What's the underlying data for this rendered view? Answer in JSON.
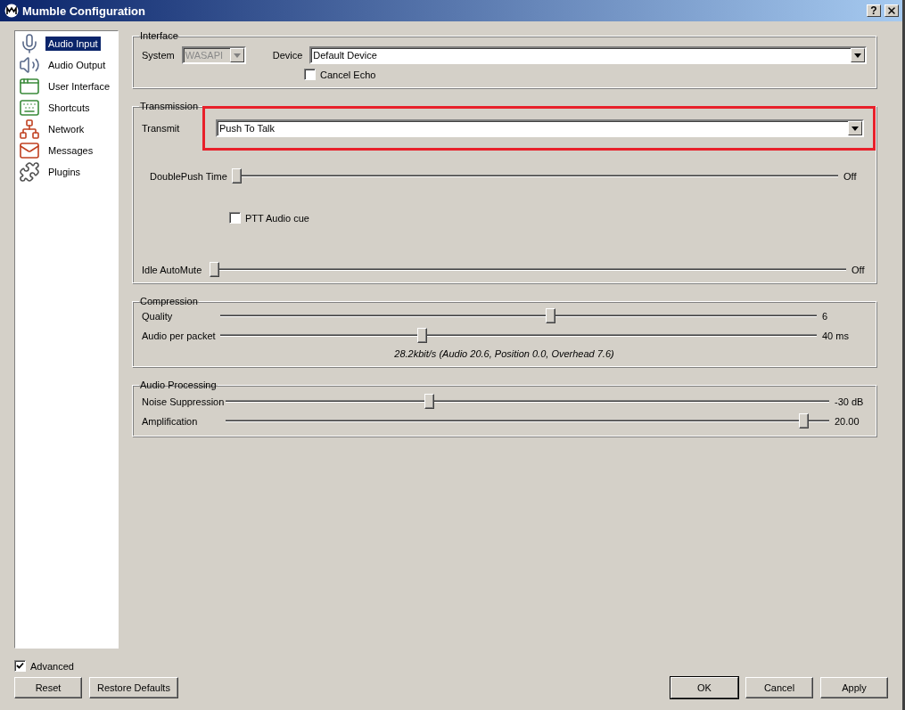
{
  "window": {
    "title": "Mumble Configuration",
    "help_button": "?"
  },
  "sidebar": {
    "items": [
      {
        "label": "Audio Input",
        "selected": true
      },
      {
        "label": "Audio Output",
        "selected": false
      },
      {
        "label": "User Interface",
        "selected": false
      },
      {
        "label": "Shortcuts",
        "selected": false
      },
      {
        "label": "Network",
        "selected": false
      },
      {
        "label": "Messages",
        "selected": false
      },
      {
        "label": "Plugins",
        "selected": false
      }
    ]
  },
  "interface": {
    "title": "Interface",
    "system": {
      "label": "System",
      "value": "WASAPI",
      "disabled": true
    },
    "device": {
      "label": "Device",
      "value": "Default Device"
    },
    "cancel_echo": {
      "label": "Cancel Echo",
      "checked": false
    }
  },
  "transmission": {
    "title": "Transmission",
    "transmit": {
      "label": "Transmit",
      "value": "Push To Talk",
      "highlighted": true
    },
    "double_push": {
      "label": "DoublePush Time",
      "level": 0,
      "reading": "Off"
    },
    "ptt_cue": {
      "label": "PTT Audio cue",
      "checked": false
    },
    "idle_automute": {
      "label": "Idle AutoMute",
      "level": 0,
      "reading": "Off"
    }
  },
  "compression": {
    "title": "Compression",
    "sliders": [
      {
        "label": "Quality",
        "level": 0.555,
        "reading": "6"
      },
      {
        "label": "Audio per packet",
        "level": 0.336,
        "reading": "40 ms"
      }
    ],
    "bitrate": "28.2kbit/s (Audio 20.6, Position 0.0, Overhead 7.6)"
  },
  "audio_processing": {
    "title": "Audio Processing",
    "sliders": [
      {
        "label": "Noise Suppression",
        "level": 0.335,
        "reading": "-30 dB"
      },
      {
        "label": "Amplification",
        "level": 0.965,
        "reading": "20.00"
      }
    ]
  },
  "advanced": {
    "label": "Advanced",
    "checked": true
  },
  "buttons": {
    "left": [
      "Reset",
      "Restore Defaults"
    ],
    "right": [
      "OK",
      "Cancel",
      "Apply"
    ]
  }
}
